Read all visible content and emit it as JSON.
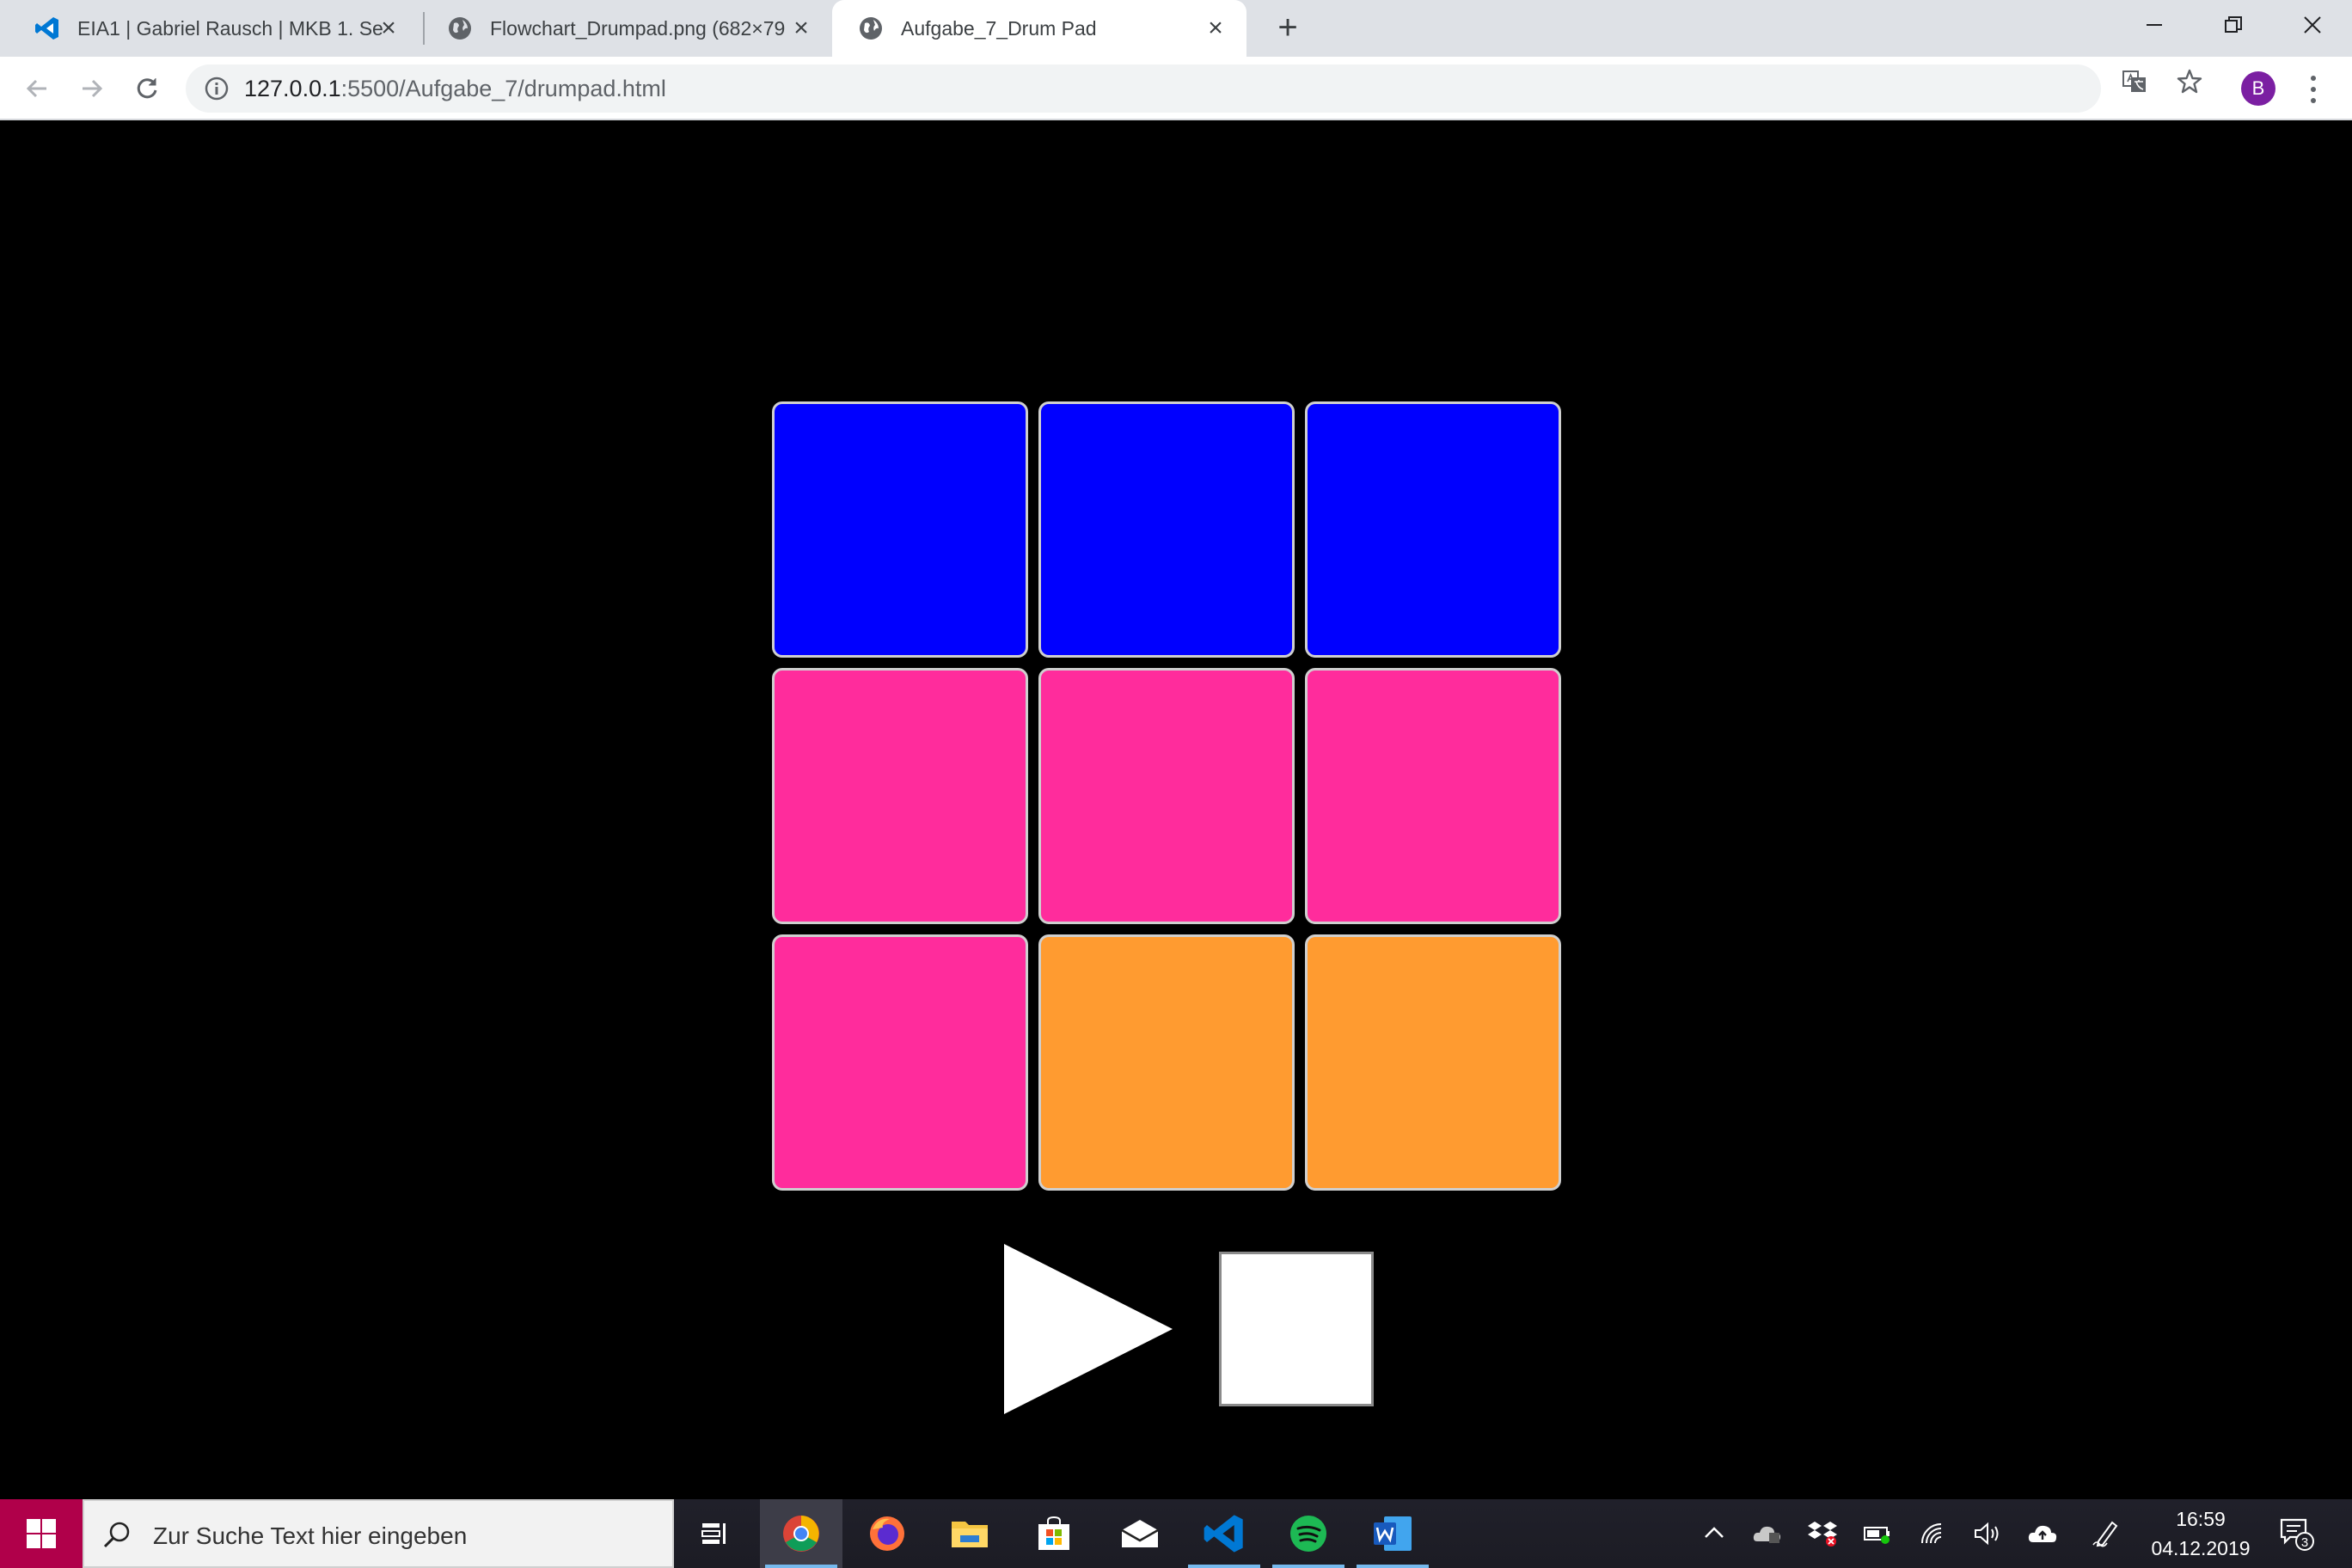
{
  "browser": {
    "tabs": [
      {
        "title": "EIA1 | Gabriel Rausch | MKB 1. Se",
        "icon": "vscode-icon",
        "active": false
      },
      {
        "title": "Flowchart_Drumpad.png (682×79",
        "icon": "globe-icon",
        "active": false
      },
      {
        "title": "Aufgabe_7_Drum Pad",
        "icon": "globe-icon",
        "active": true
      }
    ],
    "new_tab_label": "+",
    "address": {
      "host": "127.0.0.1",
      "path": ":5500/Aufgabe_7/drumpad.html"
    },
    "profile_initial": "B"
  },
  "page": {
    "pads": [
      {
        "color": "#0000ff",
        "kind": "blue"
      },
      {
        "color": "#0000ff",
        "kind": "blue"
      },
      {
        "color": "#0000ff",
        "kind": "blue"
      },
      {
        "color": "#ff2c9c",
        "kind": "pink"
      },
      {
        "color": "#ff2c9c",
        "kind": "pink"
      },
      {
        "color": "#ff2c9c",
        "kind": "pink"
      },
      {
        "color": "#ff2c9c",
        "kind": "pink"
      },
      {
        "color": "#ff9b30",
        "kind": "orange"
      },
      {
        "color": "#ff9b30",
        "kind": "orange"
      }
    ],
    "controls": {
      "play_icon": "play-icon",
      "stop_icon": "stop-icon"
    }
  },
  "taskbar": {
    "search_placeholder": "Zur Suche Text hier eingeben",
    "apps": [
      "task-view-icon",
      "chrome-icon",
      "firefox-icon",
      "file-explorer-icon",
      "store-icon",
      "mail-icon",
      "vscode-icon",
      "spotify-icon",
      "word-icon"
    ],
    "clock_time": "16:59",
    "clock_date": "04.12.2019",
    "notification_count": "3"
  }
}
